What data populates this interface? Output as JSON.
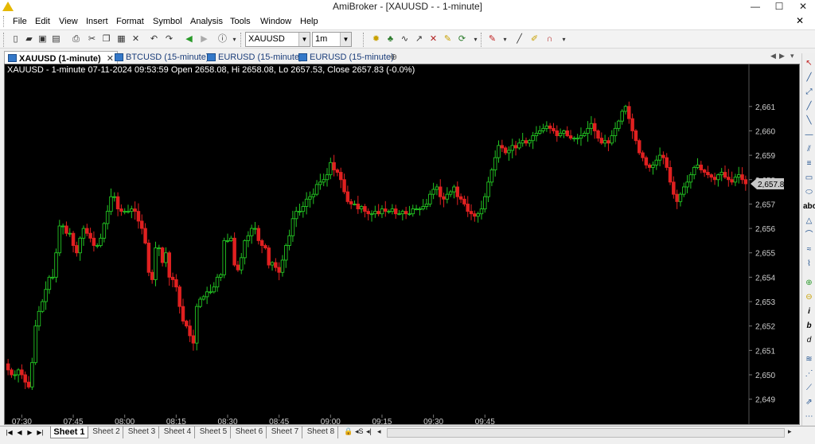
{
  "window": {
    "title": "AmiBroker - [XAUUSD -  - 1-minute]",
    "minimize": "—",
    "maximize": "☐",
    "close": "✕"
  },
  "menu": {
    "items": [
      "File",
      "Edit",
      "View",
      "Insert",
      "Format",
      "Symbol",
      "Analysis",
      "Tools",
      "Window",
      "Help"
    ],
    "mdi_close": "✕"
  },
  "toolbar": {
    "symbol": "XAUUSD",
    "interval": "1m"
  },
  "tabs": [
    {
      "label": "XAUUSD (1-minute)",
      "active": true,
      "close": "✕"
    },
    {
      "label": "BTCUSD (15-minute)",
      "active": false
    },
    {
      "label": "EURUSD (15-minute)",
      "active": false
    },
    {
      "label": "EURUSD (15-minute)",
      "active": false
    }
  ],
  "chart": {
    "header": "XAUUSD - 1-minute 07-11-2024 09:53:59 Open 2658.08, Hi 2658.08, Lo 2657.53, Close 2657.83 (-0.0%)",
    "last_price_label": "2,657.83",
    "colors": {
      "background": "#000000",
      "up": "#22c422",
      "down": "#e02020",
      "text": "#cfcfcf",
      "price_box": "#c8c8c8"
    }
  },
  "chart_data": {
    "type": "candlestick",
    "symbol": "XAUUSD",
    "interval": "1-minute",
    "y_ticks": [
      2649,
      2650,
      2651,
      2652,
      2653,
      2654,
      2655,
      2656,
      2657,
      2658,
      2659,
      2660,
      2661
    ],
    "y_tick_labels": [
      "2,649",
      "2,650",
      "2,651",
      "2,652",
      "2,653",
      "2,654",
      "2,655",
      "2,656",
      "2,657",
      "2,658",
      "2,659",
      "2,660",
      "2,661"
    ],
    "ylim": [
      2648.5,
      2662.2
    ],
    "x_ticks": [
      "07:30",
      "07:45",
      "08:00",
      "08:15",
      "08:30",
      "08:45",
      "09:00",
      "09:15",
      "09:30",
      "09:45"
    ],
    "start_time": "07:26",
    "end_time": "09:53",
    "close": [
      2650.2,
      2650.0,
      2650.0,
      2650.2,
      2650.0,
      2649.7,
      2649.5,
      2650.5,
      2652.0,
      2652.6,
      2653.0,
      2653.5,
      2654.0,
      2654.0,
      2655.0,
      2656.1,
      2656.1,
      2655.8,
      2655.8,
      2655.3,
      2655.0,
      2655.6,
      2656.0,
      2655.8,
      2655.6,
      2655.3,
      2655.3,
      2655.6,
      2656.2,
      2656.7,
      2657.3,
      2657.3,
      2656.8,
      2656.7,
      2656.7,
      2656.7,
      2656.8,
      2656.7,
      2656.3,
      2656.0,
      2655.4,
      2654.2,
      2653.9,
      2655.2,
      2655.2,
      2654.6,
      2655.0,
      2654.0,
      2653.9,
      2653.6,
      2652.8,
      2652.2,
      2652.0,
      2651.6,
      2651.3,
      2652.8,
      2653.1,
      2653.2,
      2653.4,
      2653.4,
      2653.6,
      2654.0,
      2654.1,
      2655.5,
      2655.5,
      2655.6,
      2654.5,
      2654.3,
      2654.8,
      2655.5,
      2655.7,
      2656.0,
      2656.0,
      2655.5,
      2655.3,
      2655.2,
      2654.5,
      2654.6,
      2654.4,
      2654.2,
      2654.7,
      2655.3,
      2655.7,
      2656.4,
      2656.7,
      2656.7,
      2656.9,
      2657.2,
      2657.3,
      2657.4,
      2657.8,
      2657.9,
      2658.0,
      2658.2,
      2658.7,
      2658.4,
      2658.3,
      2658.0,
      2657.5,
      2657.1,
      2657.0,
      2657.0,
      2656.8,
      2656.9,
      2656.7,
      2656.6,
      2656.6,
      2656.7,
      2656.6,
      2656.8,
      2656.7,
      2656.7,
      2656.8,
      2656.6,
      2656.6,
      2656.7,
      2656.6,
      2656.6,
      2656.8,
      2656.8,
      2656.8,
      2656.9,
      2657.0,
      2657.4,
      2657.6,
      2657.7,
      2657.3,
      2657.2,
      2657.4,
      2657.5,
      2657.7,
      2657.3,
      2657.2,
      2657.0,
      2656.7,
      2656.6,
      2656.5,
      2656.6,
      2656.8,
      2657.3,
      2657.9,
      2658.4,
      2658.9,
      2659.4,
      2659.3,
      2659.1,
      2659.2,
      2659.4,
      2659.3,
      2659.5,
      2659.6,
      2659.5,
      2659.6,
      2659.8,
      2659.9,
      2660.0,
      2660.1,
      2660.2,
      2660.1,
      2660.0,
      2659.8,
      2659.9,
      2660.0,
      2659.8,
      2659.7,
      2659.7,
      2659.7,
      2659.8,
      2659.9,
      2660.1,
      2660.3,
      2660.0,
      2659.7,
      2659.5,
      2659.6,
      2659.5,
      2659.8,
      2660.1,
      2660.4,
      2660.8,
      2661.0,
      2660.5,
      2660.0,
      2659.6,
      2659.1,
      2658.9,
      2658.6,
      2658.5,
      2658.6,
      2658.8,
      2659.0,
      2658.9,
      2658.5,
      2657.9,
      2657.4,
      2657.1,
      2657.4,
      2657.7,
      2657.9,
      2658.2,
      2658.5,
      2658.6,
      2658.4,
      2658.3,
      2658.2,
      2658.1,
      2658.0,
      2658.2,
      2658.3,
      2658.1,
      2658.0,
      2657.9,
      2658.1,
      2658.2,
      2658.0,
      2657.83
    ],
    "ohlc_last": {
      "time": "09:53:59",
      "open": 2658.08,
      "high": 2658.08,
      "low": 2657.53,
      "close": 2657.83,
      "change_pct": "-0.0%"
    },
    "grid": false
  },
  "sheets": [
    "Sheet 1",
    "Sheet 2",
    "Sheet 3",
    "Sheet 4",
    "Sheet 5",
    "Sheet 6",
    "Sheet 7",
    "Sheet 8"
  ],
  "active_sheet": "Sheet 1"
}
